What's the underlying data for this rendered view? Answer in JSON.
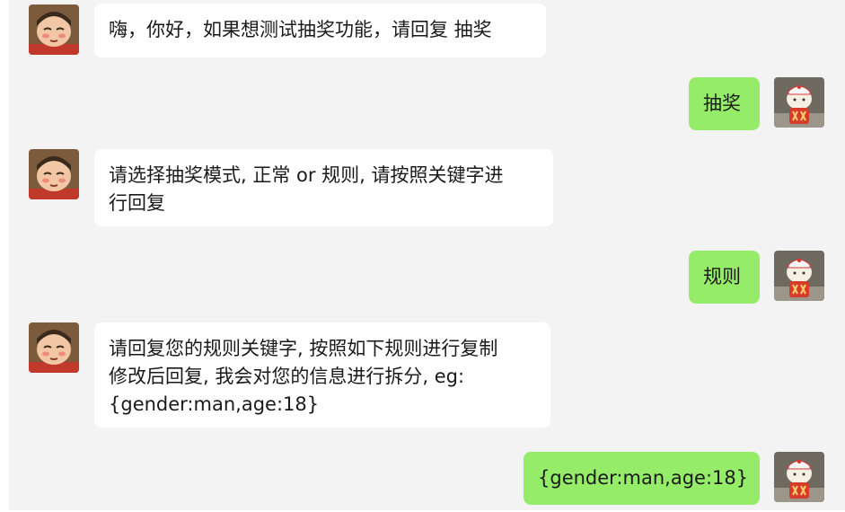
{
  "chat": {
    "messages": [
      {
        "side": "left",
        "sender": "bot",
        "lines": [
          "嗨，你好，如果想测试抽奖功能，请回复 抽奖"
        ]
      },
      {
        "side": "right",
        "sender": "user",
        "lines": [
          "抽奖"
        ]
      },
      {
        "side": "left",
        "sender": "bot",
        "lines": [
          "请选择抽奖模式, 正常 or 规则, 请按照关键字进",
          "行回复"
        ]
      },
      {
        "side": "right",
        "sender": "user",
        "lines": [
          "规则"
        ]
      },
      {
        "side": "left",
        "sender": "bot",
        "lines": [
          "请回复您的规则关键字, 按照如下规则进行复制",
          "修改后回复, 我会对您的信息进行拆分, eg:",
          "{gender:man,age:18}"
        ]
      },
      {
        "side": "right",
        "sender": "user",
        "lines": [
          "{gender:man,age:18}"
        ]
      }
    ]
  },
  "colors": {
    "chat_background": "#f3f3f3",
    "incoming_bubble": "#ffffff",
    "outgoing_bubble": "#95ec69",
    "text": "#1a1a1a"
  },
  "icons": {
    "bot_avatar": "cartoon-boy-avatar-icon",
    "user_avatar": "lucky-cat-avatar-icon"
  }
}
